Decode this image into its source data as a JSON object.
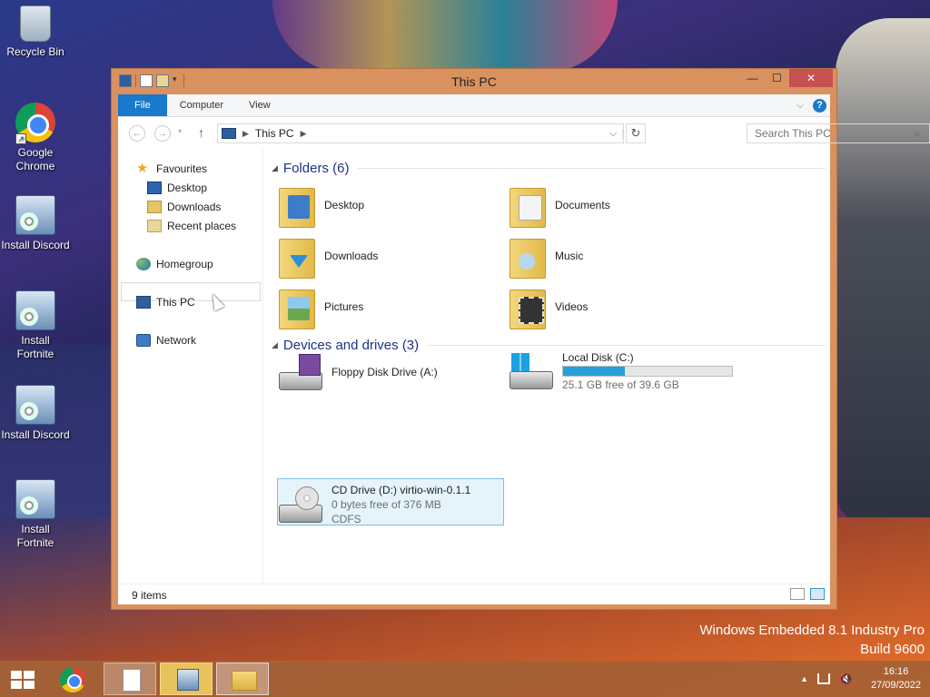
{
  "desktop": {
    "icons": [
      {
        "label": "Recycle Bin",
        "icon": "recycle-bin-icon"
      },
      {
        "label": "Google Chrome",
        "icon": "chrome-icon"
      },
      {
        "label": "Install Discord",
        "icon": "setup-icon"
      },
      {
        "label": "Install Fortnite",
        "icon": "setup-icon"
      },
      {
        "label": "Install Discord",
        "icon": "setup-icon"
      },
      {
        "label": "Install Fortnite",
        "icon": "setup-icon"
      }
    ],
    "watermark": {
      "line1": "Windows Embedded 8.1 Industry Pro",
      "line2": "Build 9600"
    }
  },
  "window": {
    "title": "This PC",
    "controls": {
      "minimize": "—",
      "maximize": "☐",
      "close": "✕"
    },
    "ribbon": {
      "tabs": [
        "File",
        "Computer",
        "View"
      ],
      "active": "File"
    },
    "address": {
      "path": "This PC",
      "search_placeholder": "Search This PC"
    },
    "navpane": {
      "favourites": "Favourites",
      "fav_items": [
        "Desktop",
        "Downloads",
        "Recent places"
      ],
      "homegroup": "Homegroup",
      "this_pc": "This PC",
      "network": "Network"
    },
    "folders": {
      "header": "Folders (6)",
      "items": [
        "Desktop",
        "Documents",
        "Downloads",
        "Music",
        "Pictures",
        "Videos"
      ]
    },
    "drives": {
      "header": "Devices and drives (3)",
      "floppy": {
        "name": "Floppy Disk Drive (A:)"
      },
      "local": {
        "name": "Local Disk (C:)",
        "free": "25.1 GB free of 39.6 GB",
        "used_fraction": 0.366
      },
      "cd": {
        "name": "CD Drive (D:) virtio-win-0.1.1",
        "free": "0 bytes free of 376 MB",
        "fs": "CDFS"
      }
    },
    "status": {
      "item_count": "9 items"
    }
  },
  "taskbar": {
    "time": "16:16",
    "date": "27/09/2022"
  },
  "colors": {
    "accent": "#1979ca",
    "window_frame": "#d9915f",
    "taskbar": "#a86234",
    "close": "#c75050"
  }
}
